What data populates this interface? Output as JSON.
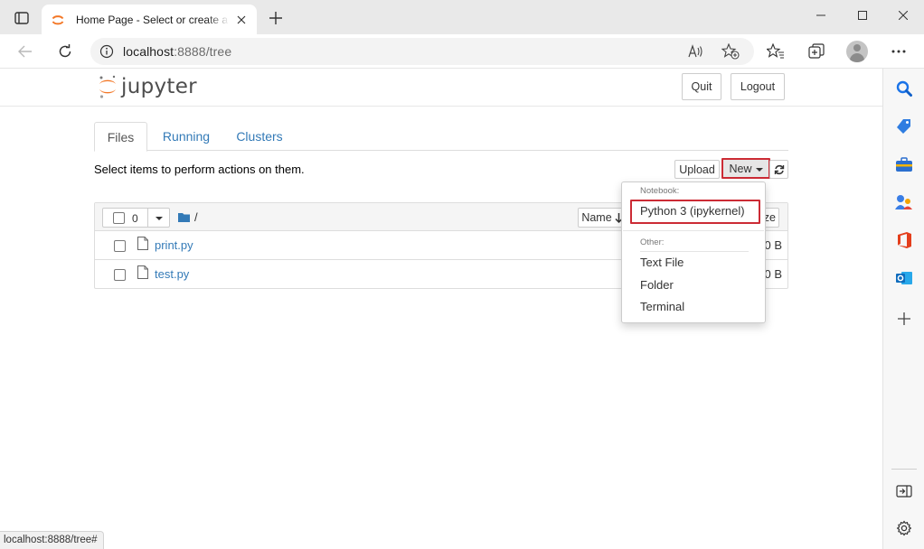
{
  "browser": {
    "tab_title": "Home Page - Select or create a notebook",
    "address": {
      "host": "localhost",
      "path": ":8888/tree"
    },
    "status_url": "localhost:8888/tree#"
  },
  "jupyter": {
    "logo_text": "jupyter",
    "header_buttons": {
      "quit": "Quit",
      "logout": "Logout"
    },
    "tabs": [
      {
        "label": "Files",
        "active": true
      },
      {
        "label": "Running",
        "active": false
      },
      {
        "label": "Clusters",
        "active": false
      }
    ],
    "hint": "Select items to perform actions on them.",
    "toolbar": {
      "upload": "Upload",
      "new": "New"
    },
    "list": {
      "selected_count": "0",
      "breadcrumb": "/",
      "sort_label": "Name",
      "size_label_partial": "ze",
      "files": [
        {
          "name": "print.py",
          "size": "0 B"
        },
        {
          "name": "test.py",
          "size": "0 B"
        }
      ]
    },
    "new_menu": {
      "notebook_header": "Notebook:",
      "notebook_items": [
        "Python 3 (ipykernel)"
      ],
      "other_header": "Other:",
      "other_items": [
        "Text File",
        "Folder",
        "Terminal"
      ]
    }
  },
  "colors": {
    "jupyter_orange": "#f37726",
    "link_blue": "#337ab7",
    "highlight_red": "#cc2b35"
  }
}
